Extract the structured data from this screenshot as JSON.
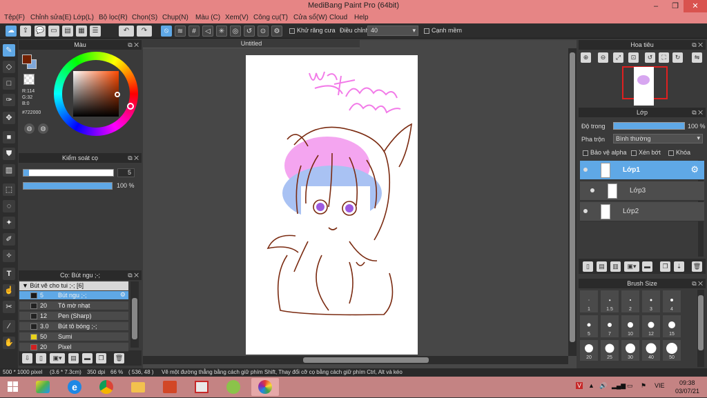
{
  "window": {
    "title": "MediBang Paint Pro (64bit)"
  },
  "menu": [
    "Tệp(F)",
    "Chỉnh sửa(E)",
    "Lớp(L)",
    "Bộ lọc(R)",
    "Chọn(S)",
    "Chụp(N)",
    "Màu (C)",
    "Xem(V)",
    "Công cụ(T)",
    "Cửa sổ(W)",
    "Cloud",
    "Help"
  ],
  "toolbar": {
    "antialias_label": "Khử răng cưa",
    "correction_label": "Điều chỉnh",
    "correction_value": "40",
    "soft_edge_label": "Cạnh mềm"
  },
  "color_panel": {
    "title": "Màu",
    "r": "R:114",
    "g": "G:32",
    "b": "B:0",
    "hex": "#722000",
    "fg_color": "#722000",
    "bg_color": "#7fa7d9"
  },
  "brush_control": {
    "title": "Kiểm soát cọ",
    "size": "5",
    "opacity": "100 %"
  },
  "brush_panel": {
    "title": "Cọ: Bút ngu ;-;",
    "group": "Bút vẽ cho tui ;-; [6]",
    "items": [
      {
        "size": "5",
        "name": "Bút ngu ;-;",
        "color": "#1a1a1a",
        "selected": true
      },
      {
        "size": "20",
        "name": "Tô mờ nhạt",
        "color": "#222222",
        "selected": false
      },
      {
        "size": "12",
        "name": "Pen (Sharp)",
        "color": "#222222",
        "selected": false
      },
      {
        "size": "3.0",
        "name": "Bút tô bóng ;-;",
        "color": "#222222",
        "selected": false
      },
      {
        "size": "50",
        "name": "Sumi",
        "color": "#e8d21a",
        "selected": false
      },
      {
        "size": "20",
        "name": "Pixel",
        "color": "#d02020",
        "selected": false
      }
    ]
  },
  "canvas": {
    "tab": "Untitled"
  },
  "navigator": {
    "title": "Hoa tiêu"
  },
  "layer_panel": {
    "title": "Lớp",
    "opacity_label": "Độ trong",
    "opacity_value": "100 %",
    "blend_label": "Pha trộn",
    "blend_value": "Bình thường",
    "protect_alpha": "Bảo vệ alpha",
    "clipping": "Xén bớt",
    "lock": "Khóa",
    "layers": [
      {
        "name": "Lớp1",
        "selected": true
      },
      {
        "name": "Lớp3",
        "selected": false
      },
      {
        "name": "Lớp2",
        "selected": false
      }
    ]
  },
  "brush_size": {
    "title": "Brush Size",
    "sizes": [
      "1",
      "1.5",
      "2",
      "3",
      "4",
      "5",
      "7",
      "10",
      "12",
      "15",
      "20",
      "25",
      "30",
      "40",
      "50"
    ]
  },
  "status": {
    "size": "500 * 1000 pixel",
    "cm": "(3.6 * 7.3cm)",
    "dpi": "350 dpi",
    "zoom": "66 %",
    "coords": "( 536, 48 )",
    "hint": "Vẽ một đường thẳng bằng cách giữ phím Shift, Thay đổi cỡ cọ bằng cách giữ phím Ctrl, Alt và kéo"
  },
  "taskbar": {
    "lang": "VIE",
    "time": "09:38",
    "date": "03/07/21"
  }
}
